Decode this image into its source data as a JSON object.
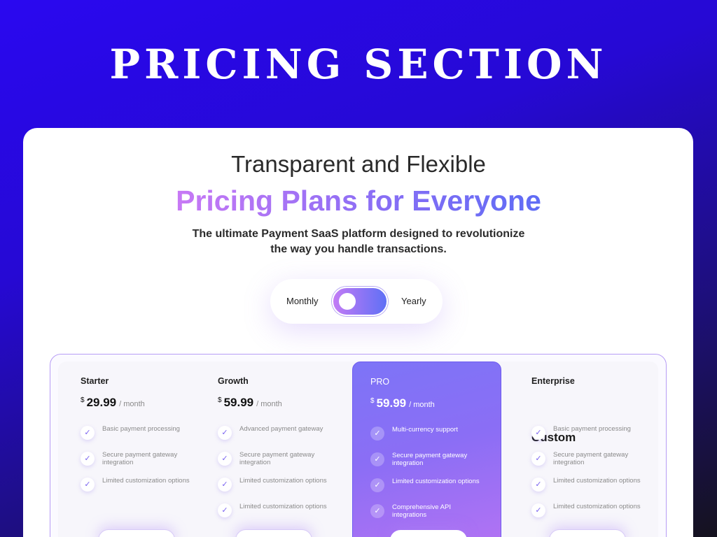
{
  "hero": {
    "title": "PRICING SECTION"
  },
  "header": {
    "line1": "Transparent and Flexible",
    "line2": "Pricing Plans for Everyone",
    "subtitle": "The ultimate Payment SaaS platform designed to revolutionize the way you handle transactions."
  },
  "billing_toggle": {
    "monthly_label": "Monthly",
    "yearly_label": "Yearly",
    "selected": "Monthly"
  },
  "colors": {
    "accent_start": "#c37bf5",
    "accent_end": "#5f70f5",
    "check": "#7a63f0",
    "background": "#2609d4"
  },
  "plans": [
    {
      "name": "Starter",
      "currency": "$",
      "amount": "29.99",
      "period": "/ month",
      "features": [
        "Basic payment processing",
        "Secure payment gateway integration",
        "Limited customization options"
      ]
    },
    {
      "name": "Growth",
      "currency": "$",
      "amount": "59.99",
      "period": "/ month",
      "features": [
        "Advanced payment gateway",
        "Secure payment gateway integration",
        "Limited customization options",
        "Limited customization options"
      ]
    },
    {
      "name": "PRO",
      "currency": "$",
      "amount": "59.99",
      "period": "/ month",
      "features": [
        "Multi-currency support",
        "Secure payment gateway integration",
        "Limited customization options",
        "Comprehensive API integrations"
      ]
    },
    {
      "name": "Enterprise",
      "custom_price": "Custom",
      "features": [
        "Basic payment processing",
        "Secure payment gateway integration",
        "Limited customization options",
        "Limited customization options"
      ]
    }
  ],
  "icons": {
    "feature_check": "check-icon"
  }
}
